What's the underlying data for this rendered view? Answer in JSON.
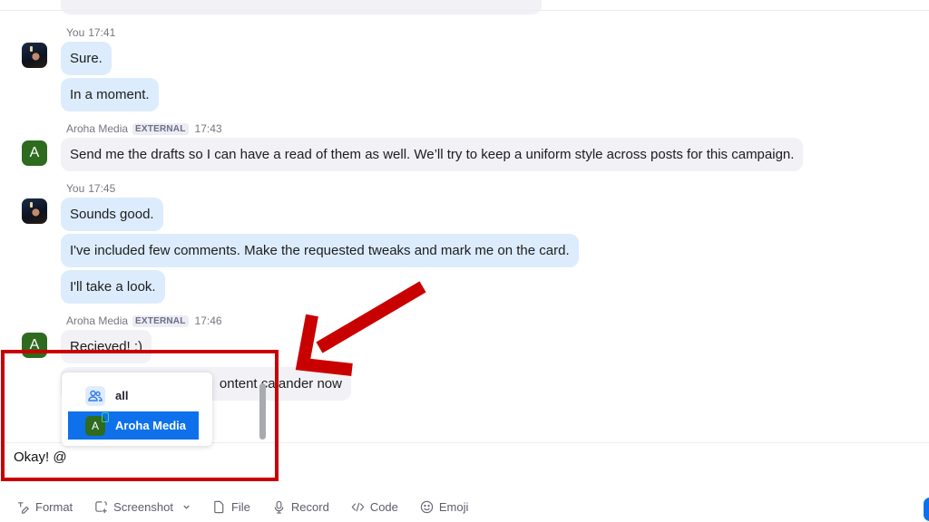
{
  "messages": [
    {
      "sender": "You",
      "time": "17:41",
      "external": false,
      "avatar": "user-photo",
      "lines": [
        "Sure.",
        "In a moment."
      ]
    },
    {
      "sender": "Aroha Media",
      "badge": "EXTERNAL",
      "time": "17:43",
      "external": true,
      "avatar_letter": "A",
      "lines": [
        "Send me the drafts so I can have a read of them as well. We’ll try to keep a uniform style across posts for this campaign."
      ]
    },
    {
      "sender": "You",
      "time": "17:45",
      "external": false,
      "avatar": "user-photo",
      "lines": [
        "Sounds good.",
        "I've included few comments. Make the requested tweaks and mark me on the card.",
        "I'll take a look."
      ]
    },
    {
      "sender": "Aroha Media",
      "badge": "EXTERNAL",
      "time": "17:46",
      "external": true,
      "avatar_letter": "A",
      "lines": [
        "Recieved! :)",
        "ontent calander now"
      ]
    }
  ],
  "mention_popup": {
    "items": [
      {
        "label": "all",
        "icon": "group-icon",
        "selected": false
      },
      {
        "label": "Aroha Media",
        "icon": "avatar-letter",
        "avatar_letter": "A",
        "selected": true
      }
    ]
  },
  "composer": {
    "value": "Okay! @"
  },
  "toolbar": {
    "items": [
      {
        "label": "Format",
        "icon": "format-icon"
      },
      {
        "label": "Screenshot",
        "icon": "screenshot-icon",
        "has_dropdown": true
      },
      {
        "label": "File",
        "icon": "file-icon"
      },
      {
        "label": "Record",
        "icon": "microphone-icon"
      },
      {
        "label": "Code",
        "icon": "code-icon"
      },
      {
        "label": "Emoji",
        "icon": "emoji-icon"
      }
    ]
  },
  "colors": {
    "accent": "#0e71eb",
    "my_bubble": "#dcecfd",
    "their_bubble": "#f1f1f6",
    "external_avatar": "#2e6b1f",
    "annotation": "#c90000"
  }
}
